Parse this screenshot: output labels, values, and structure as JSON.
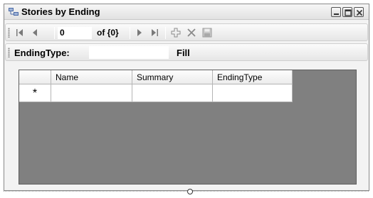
{
  "window": {
    "title": "Stories by Ending"
  },
  "navigator": {
    "position_value": "0",
    "count_label": "of {0}"
  },
  "filter": {
    "label": "EndingType:",
    "value": "",
    "fill_label": "Fill"
  },
  "grid": {
    "columns": [
      "Name",
      "Summary",
      "EndingType"
    ],
    "new_row_marker": "*",
    "background_color": "#808080"
  },
  "icons": {
    "move_first": "move-first-icon",
    "move_previous": "move-previous-icon",
    "move_next": "move-next-icon",
    "move_last": "move-last-icon",
    "add_new": "add-new-icon",
    "delete": "delete-icon",
    "save": "save-icon"
  }
}
